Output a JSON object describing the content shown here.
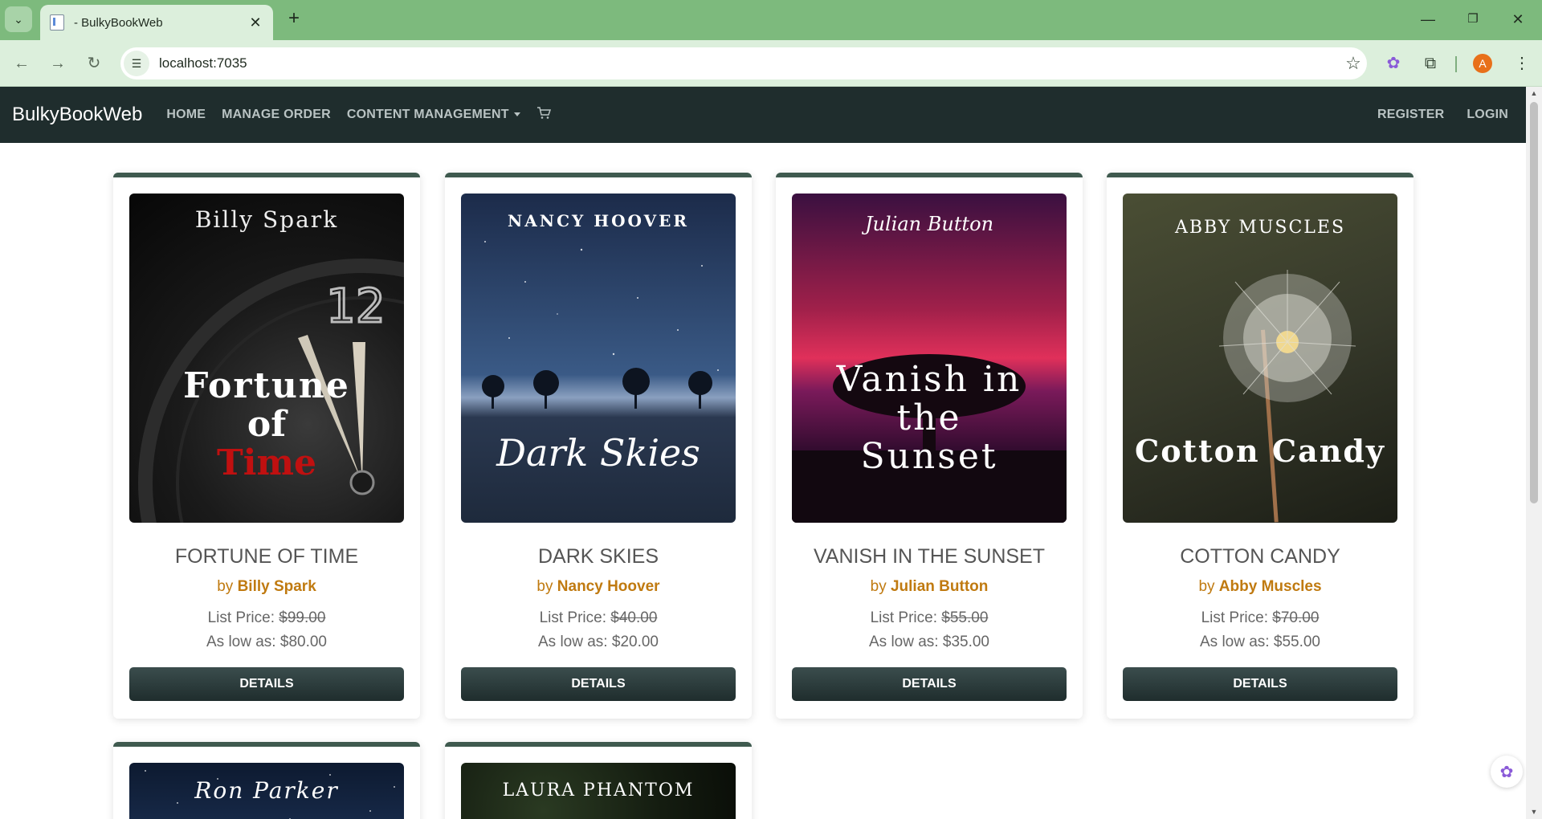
{
  "browser": {
    "tab_title": "- BulkyBookWeb",
    "url": "localhost:7035",
    "avatar_letter": "A",
    "new_tab_glyph": "+",
    "close_glyph": "✕"
  },
  "navbar": {
    "brand": "BulkyBookWeb",
    "links": [
      "HOME",
      "MANAGE ORDER",
      "CONTENT MANAGEMENT"
    ],
    "cart_icon": "cart-icon",
    "right_links": [
      "REGISTER",
      "LOGIN"
    ]
  },
  "products": [
    {
      "cover_author": "Billy Spark",
      "cover_title_1": "Fortune",
      "cover_title_2": "of",
      "cover_title_3": "Time",
      "title": "FORTUNE OF TIME",
      "by": "by",
      "author": "Billy Spark",
      "list_price_label": "List Price:",
      "list_price": "$99.00",
      "low_label": "As low as:",
      "low_price": "$80.00",
      "button": "DETAILS"
    },
    {
      "cover_author": "NANCY HOOVER",
      "cover_title_1": "Dark Skies",
      "title": "DARK SKIES",
      "by": "by",
      "author": "Nancy Hoover",
      "list_price_label": "List Price:",
      "list_price": "$40.00",
      "low_label": "As low as:",
      "low_price": "$20.00",
      "button": "DETAILS"
    },
    {
      "cover_author": "Julian Button",
      "cover_title_1": "Vanish in",
      "cover_title_2": "the",
      "cover_title_3": "Sunset",
      "title": "VANISH IN THE SUNSET",
      "by": "by",
      "author": "Julian Button",
      "list_price_label": "List Price:",
      "list_price": "$55.00",
      "low_label": "As low as:",
      "low_price": "$35.00",
      "button": "DETAILS"
    },
    {
      "cover_author": "ABBY MUSCLES",
      "cover_title_1": "Cotton Candy",
      "title": "COTTON CANDY",
      "by": "by",
      "author": "Abby Muscles",
      "list_price_label": "List Price:",
      "list_price": "$70.00",
      "low_label": "As low as:",
      "low_price": "$55.00",
      "button": "DETAILS"
    },
    {
      "cover_author": "Ron Parker"
    },
    {
      "cover_author": "LAURA PHANTOM"
    }
  ],
  "colors": {
    "browser_frame": "#7dba7d",
    "navbar": "#1f2d2d",
    "author_accent": "#c07a10",
    "card_top_border": "#3f5a4f"
  }
}
